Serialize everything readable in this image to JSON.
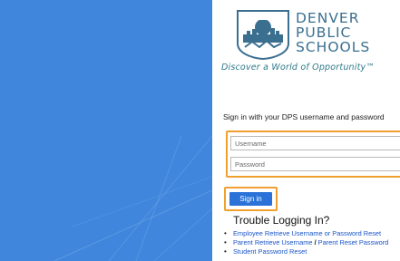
{
  "logo": {
    "line1": "DENVER",
    "line2": "PUBLIC",
    "line3": "SCHOOLS",
    "tagline": "Discover a World of Opportunity™"
  },
  "form": {
    "heading": "Sign in with your DPS username and password",
    "username_placeholder": "Username",
    "password_placeholder": "Password",
    "signin_label": "Sign in"
  },
  "trouble": {
    "heading": "Trouble Logging In?",
    "links": {
      "employee": "Employee Retrieve Username or Password Reset",
      "parent_username": "Parent Retrieve Username",
      "separator": "/",
      "parent_reset": "Parent Reset Password",
      "student": "Student Password Reset"
    }
  },
  "colors": {
    "panel_blue": "#3f86dc",
    "highlight_orange": "#f0a030",
    "button_blue": "#2a72d8",
    "logo_teal": "#3a6f8f"
  }
}
